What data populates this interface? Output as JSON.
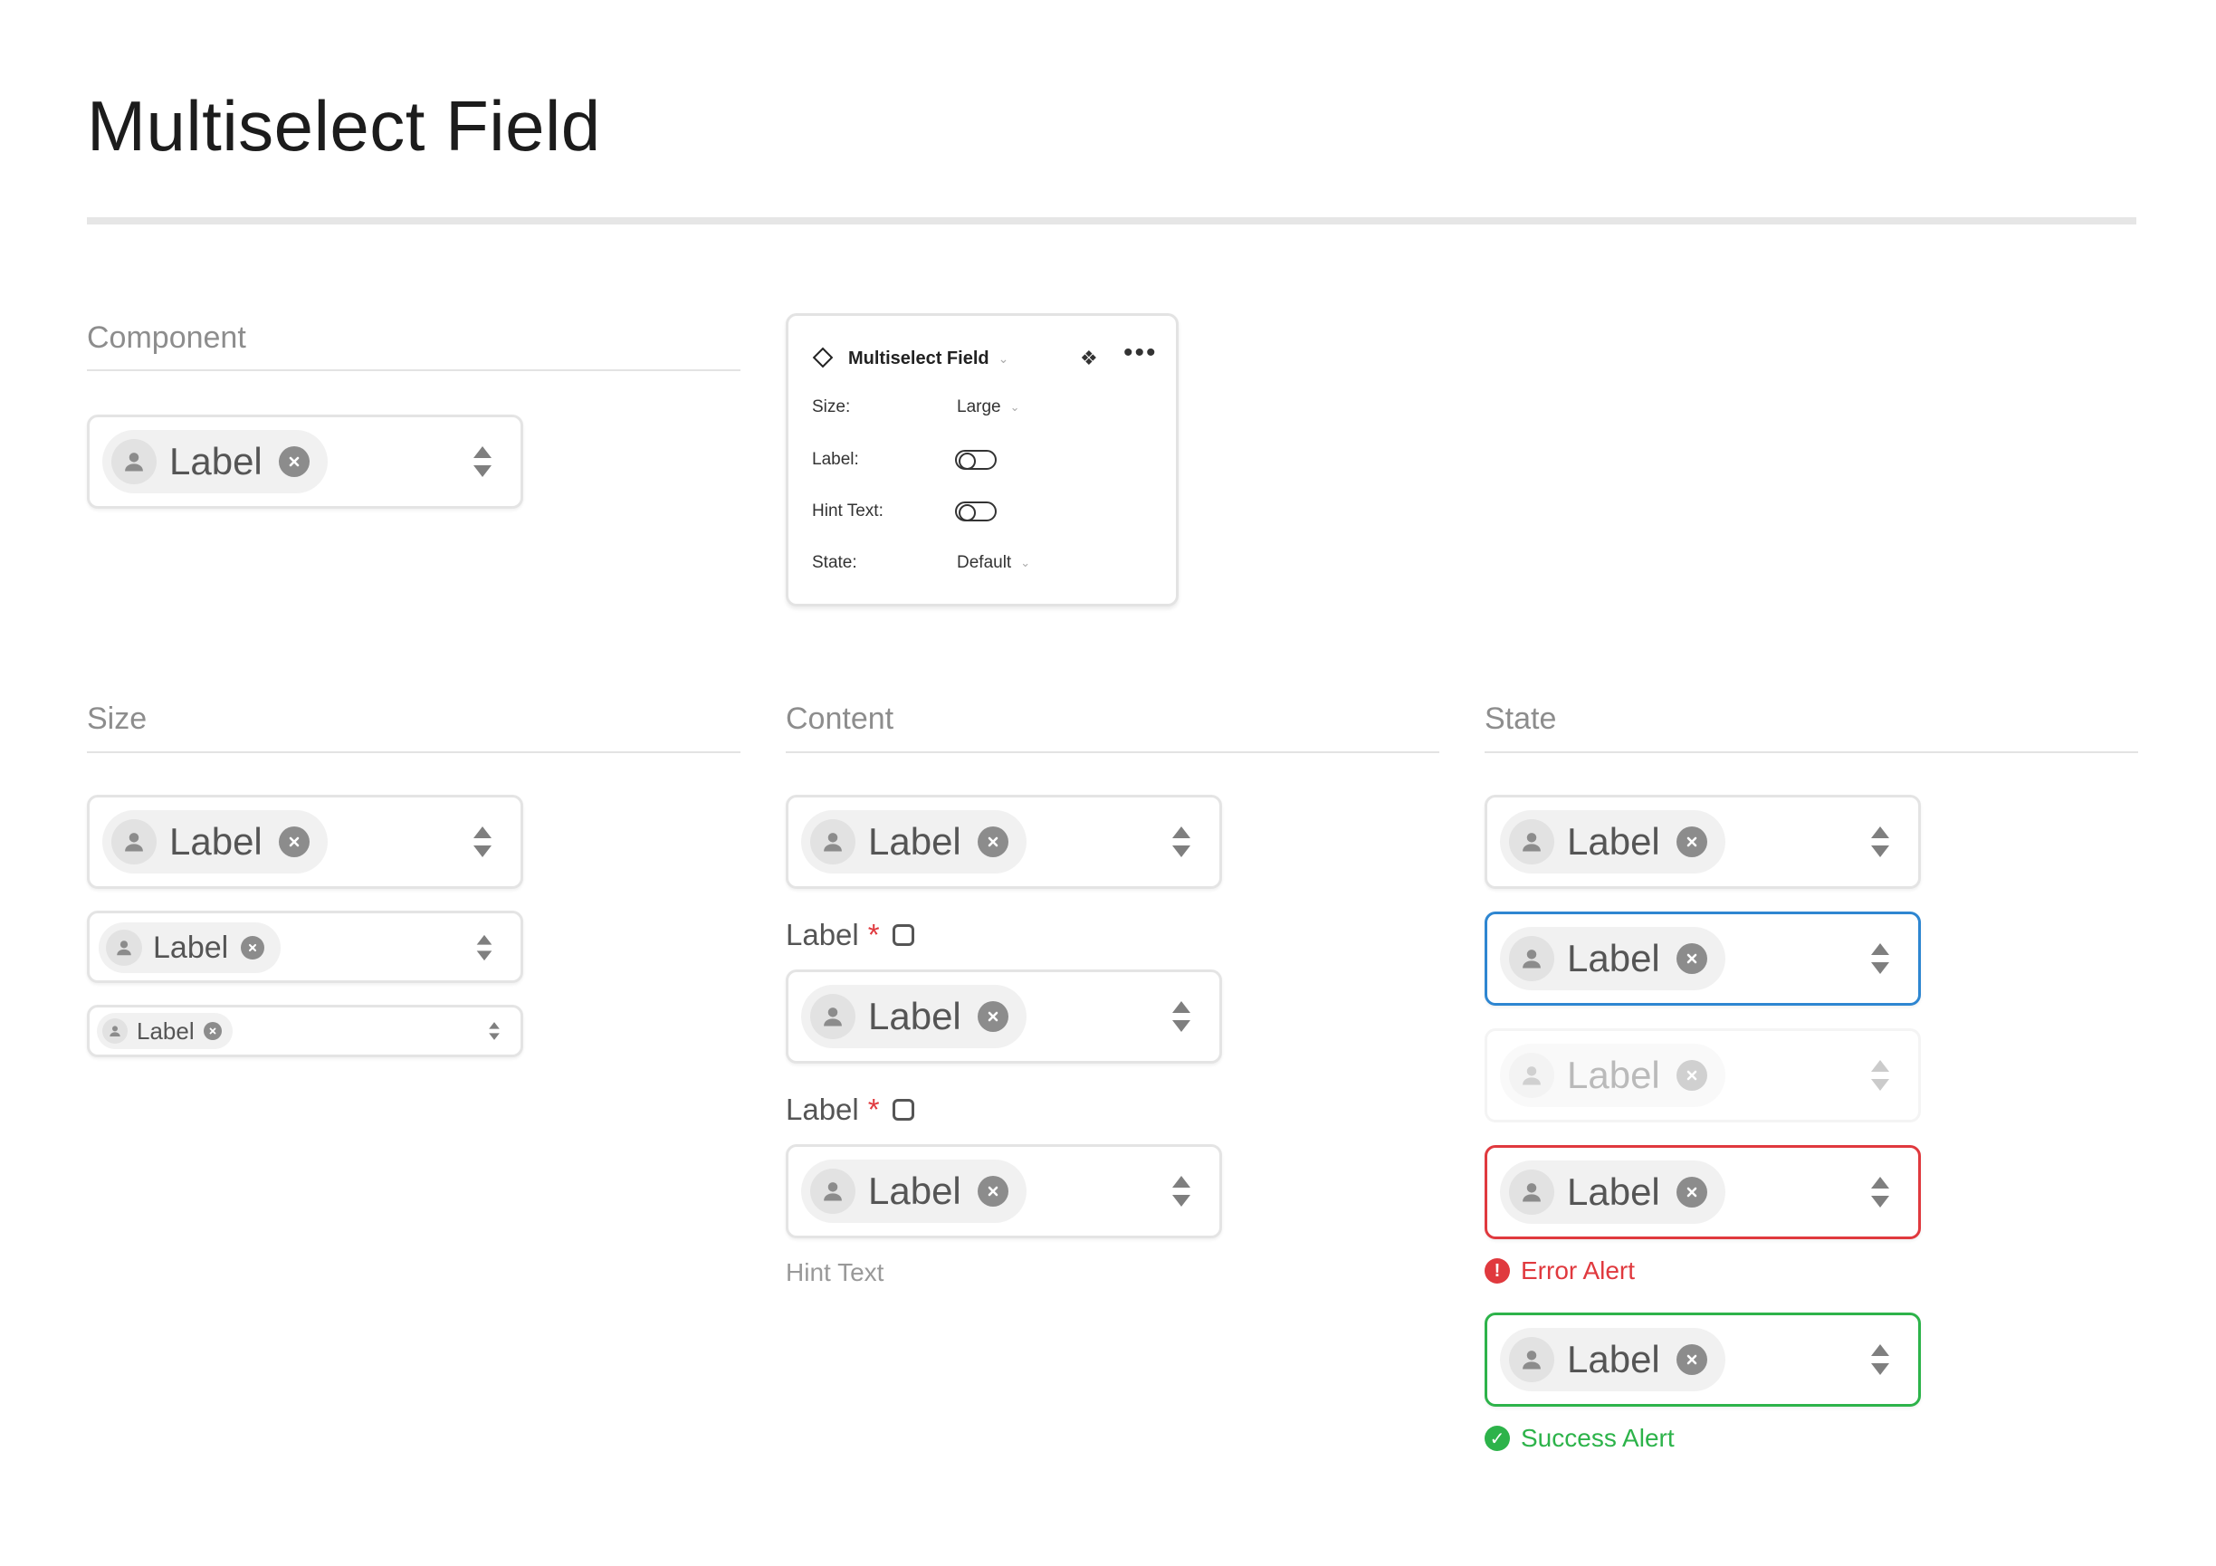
{
  "page": {
    "title": "Multiselect Field"
  },
  "sections": {
    "component": "Component",
    "size": "Size",
    "content": "Content",
    "state": "State"
  },
  "chip": {
    "label": "Label"
  },
  "field_label": {
    "text": "Label",
    "required_mark": "*"
  },
  "hint_text": "Hint Text",
  "alerts": {
    "error": "Error Alert",
    "success": "Success Alert"
  },
  "panel": {
    "title": "Multiselect Field",
    "props": [
      {
        "name": "Size:",
        "value": "Large",
        "type": "dropdown"
      },
      {
        "name": "Label:",
        "type": "toggle",
        "on": false
      },
      {
        "name": "Hint Text:",
        "type": "toggle",
        "on": false
      },
      {
        "name": "State:",
        "value": "Default",
        "type": "dropdown"
      }
    ]
  },
  "colors": {
    "focus": "#2e86d1",
    "error": "#e0393e",
    "success": "#2db34a",
    "border": "#e4e4e4"
  },
  "icons": [
    "user-avatar-icon",
    "remove-chip-icon",
    "stepper-icon",
    "component-diamond-icon",
    "move-icon",
    "more-icon",
    "error-icon",
    "success-icon",
    "info-icon",
    "chevron-down-icon"
  ]
}
